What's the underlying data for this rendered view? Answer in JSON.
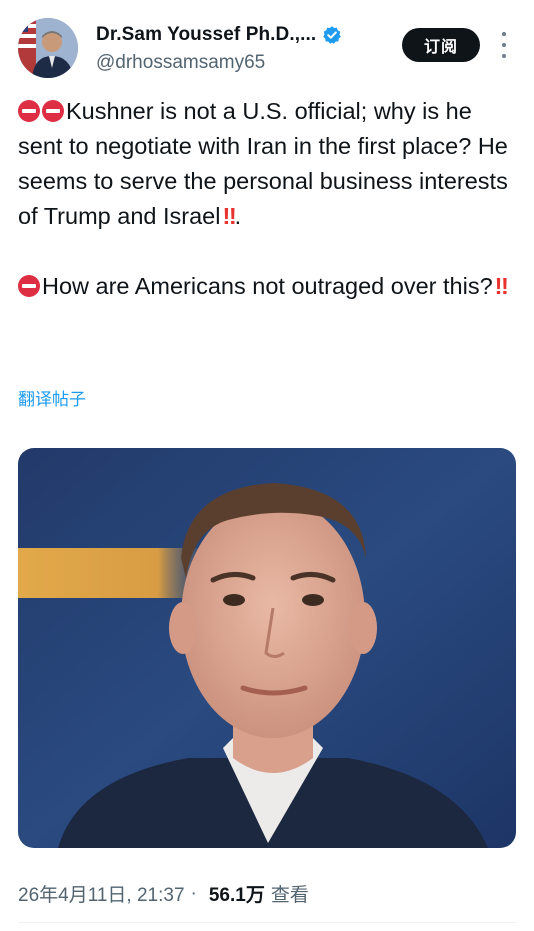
{
  "author": {
    "display_name": "Dr.Sam Youssef Ph.D.,...",
    "handle": "@drhossamsamy65"
  },
  "actions": {
    "subscribe_label": "订阅",
    "more_icon": "more-vertical-icon"
  },
  "tweet": {
    "para1_text": "Kushner is not a U.S. official; why is he sent to negotiate with Iran in the first place? He seems to serve the personal business interests of Trump and Israel",
    "para1_end_punct": ".",
    "para2_text": "How are Americans not outraged over this?",
    "emoji_bang": "‼"
  },
  "translate_label": "翻译帖子",
  "meta": {
    "timestamp": "26年4月11日, 21:37",
    "separator": "·",
    "views_count": "56.1万",
    "views_label": "查看"
  },
  "colors": {
    "accent": "#1d9bf0",
    "verified": "#1d9bf0",
    "stop_emoji": "#dd2e44",
    "bang_emoji": "#e8322d",
    "subscribe_bg": "#0f1419"
  }
}
